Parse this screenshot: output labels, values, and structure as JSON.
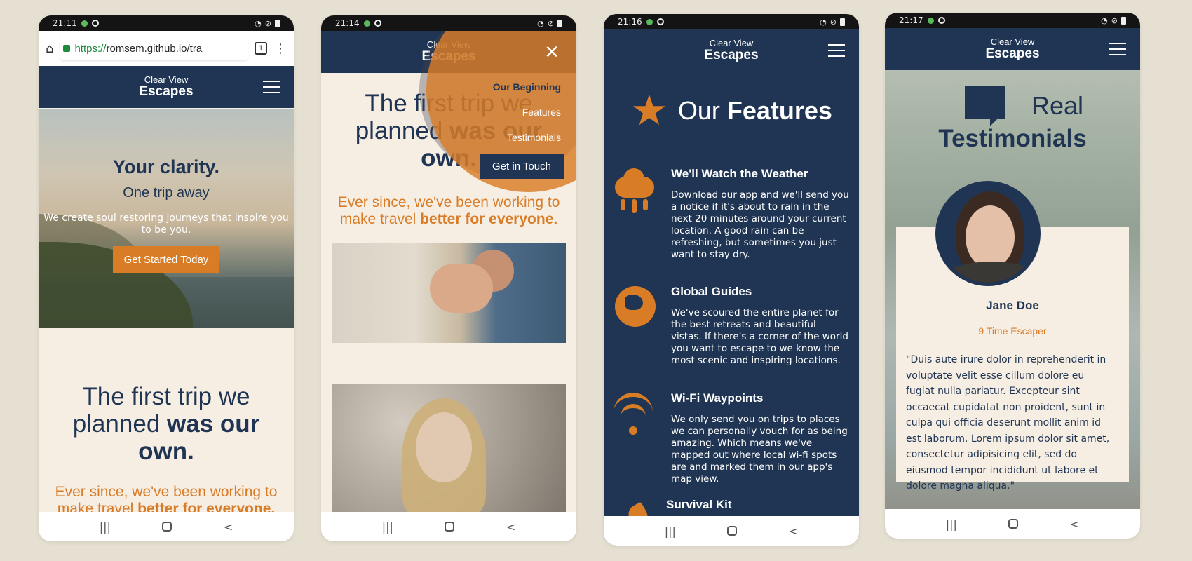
{
  "phones": {
    "p1": {
      "time": "21:11",
      "url_https": "https://",
      "url_rest": "romsem.github.io/tra",
      "tab_count": "1",
      "logo_l1": "Clear View",
      "logo_l2": "Escapes",
      "hero_title": "Your clarity.",
      "hero_sub": "One trip away",
      "hero_desc": "We create soul restoring journeys that inspire you to be you.",
      "cta": "Get Started Today",
      "sec_title_plain": "The first trip we planned ",
      "sec_title_bold": "was our own.",
      "sec_sub_plain": "Ever since, we've been working to make travel ",
      "sec_sub_bold": "better for everyone."
    },
    "p2": {
      "time": "21:14",
      "logo_l1": "Clear View",
      "logo_l2": "Escapes",
      "menu": [
        "Our Beginning",
        "Features",
        "Testimonials"
      ],
      "get_in_touch": "Get in Touch",
      "sec_title_plain": "The first trip we planned ",
      "sec_title_bold": "was our own.",
      "sec_sub_plain": "Ever since, we've been working to make travel ",
      "sec_sub_bold": "better for everyone."
    },
    "p3": {
      "time": "21:16",
      "logo_l1": "Clear View",
      "logo_l2": "Escapes",
      "title_plain": "Our ",
      "title_bold": "Features",
      "features": [
        {
          "title": "We'll Watch the Weather",
          "text": "Download our app and we'll send you a notice if it's about to rain in the next 20 minutes around your current location. A good rain can be refreshing, but sometimes you just want to stay dry."
        },
        {
          "title": "Global Guides",
          "text": "We've scoured the entire planet for the best retreats and beautiful vistas. If there's a corner of the world you want to escape to we know the most scenic and inspiring locations."
        },
        {
          "title": "Wi-Fi Waypoints",
          "text": "We only send you on trips to places we can personally vouch for as being amazing. Which means we've mapped out where local wi-fi spots are and marked them in our app's map view."
        },
        {
          "title": "Survival Kit",
          "text": ""
        }
      ]
    },
    "p4": {
      "time": "21:17",
      "logo_l1": "Clear View",
      "logo_l2": "Escapes",
      "title_l1": "Real",
      "title_l2": "Testimonials",
      "name": "Jane Doe",
      "role": "9 Time Escaper",
      "quote": "\"Duis aute irure dolor in reprehenderit in voluptate velit esse cillum dolore eu fugiat nulla pariatur. Excepteur sint occaecat cupidatat non proident, sunt in culpa qui officia deserunt mollit anim id est laborum. Lorem ipsum dolor sit amet, consectetur adipisicing elit, sed do eiusmod tempor incididunt ut labore et dolore magna aliqua.\""
    }
  },
  "nav_buttons": {
    "recents": "|||",
    "back": "<"
  },
  "colors": {
    "navy": "#1f3553",
    "orange": "#d97c26",
    "cream": "#f6ede3",
    "background": "#e6e0d2"
  }
}
